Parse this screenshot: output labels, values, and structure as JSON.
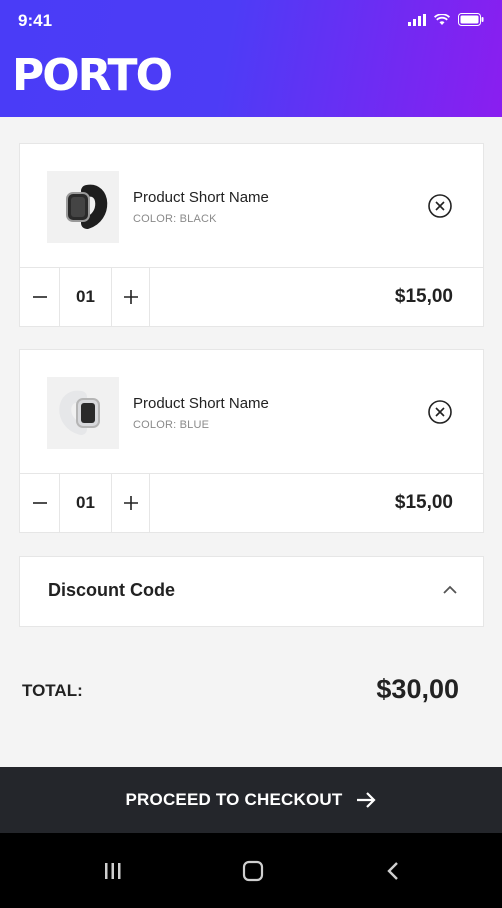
{
  "status_bar": {
    "time": "9:41"
  },
  "header": {
    "brand": "PORTO"
  },
  "cart": {
    "items": [
      {
        "name": "Product Short Name",
        "color": "COLOR: BLACK",
        "qty": "01",
        "price": "$15,00",
        "band_color": "#1e1e1e"
      },
      {
        "name": "Product Short Name",
        "color": "COLOR: BLUE",
        "qty": "01",
        "price": "$15,00",
        "band_color": "#e9eaec"
      }
    ]
  },
  "discount": {
    "label": "Discount Code"
  },
  "summary": {
    "total_label": "TOTAL:",
    "total_value": "$30,00"
  },
  "checkout": {
    "label": "PROCEED TO CHECKOUT"
  },
  "colors": {
    "accent_start": "#4a3cf7",
    "accent_end": "#8a1ef0",
    "checkout_bg": "#24262b"
  }
}
